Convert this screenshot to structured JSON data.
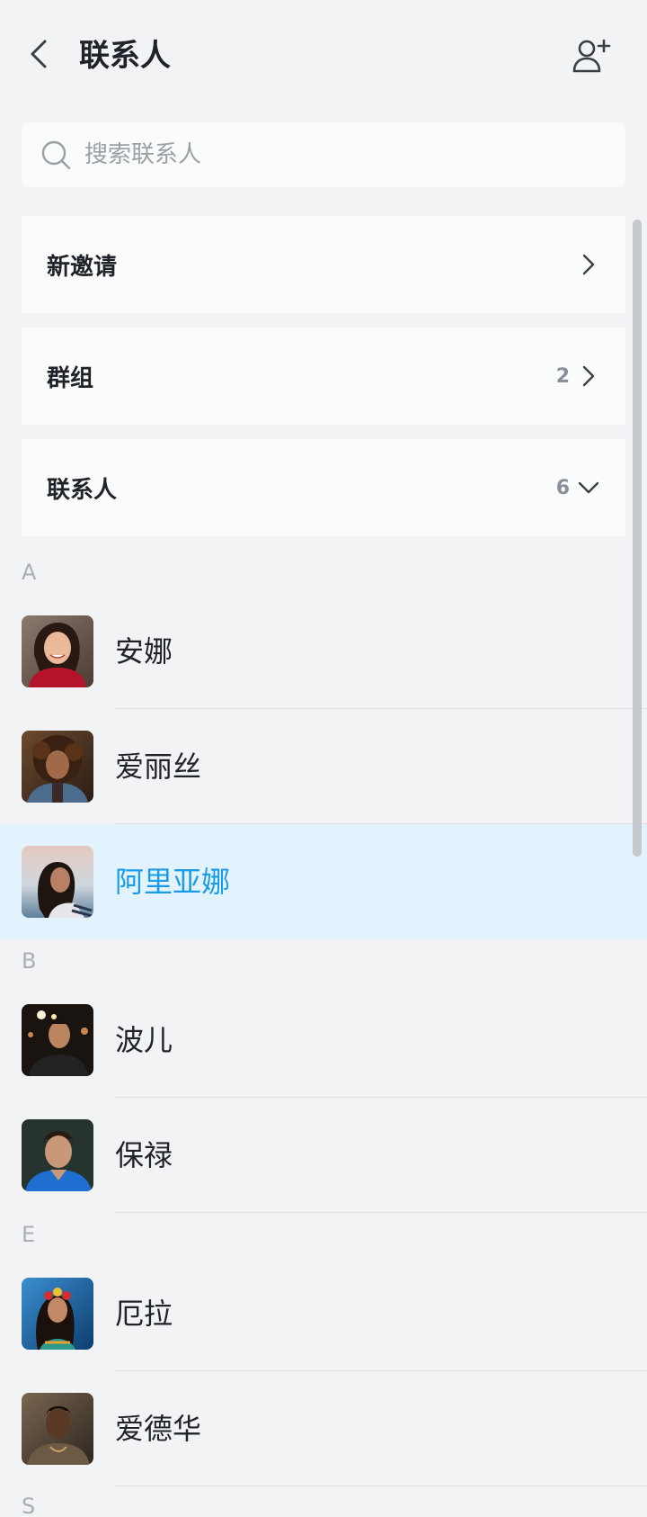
{
  "header": {
    "title": "联系人",
    "back_icon": "chevron-left-icon",
    "add_icon": "add-user-icon"
  },
  "search": {
    "placeholder": "搜索联系人",
    "value": ""
  },
  "menu": [
    {
      "label": "新邀请",
      "count": "",
      "chevron": "chevron-right-icon"
    },
    {
      "label": "群组",
      "count": "2",
      "chevron": "chevron-right-icon"
    },
    {
      "label": "联系人",
      "count": "6",
      "chevron": "chevron-down-icon"
    }
  ],
  "sections": [
    {
      "letter": "A",
      "contacts": [
        {
          "name": "安娜",
          "selected": false
        },
        {
          "name": "爱丽丝",
          "selected": false
        },
        {
          "name": "阿里亚娜",
          "selected": true
        }
      ]
    },
    {
      "letter": "B",
      "contacts": [
        {
          "name": "波儿",
          "selected": false
        },
        {
          "name": "保禄",
          "selected": false
        }
      ]
    },
    {
      "letter": "E",
      "contacts": [
        {
          "name": "厄拉",
          "selected": false
        },
        {
          "name": "爱德华",
          "selected": false
        }
      ]
    },
    {
      "letter": "S",
      "contacts": []
    }
  ],
  "colors": {
    "background": "#f2f3f5",
    "card": "#fafbfb",
    "selected_bg": "#e3f3fe",
    "selected_text": "#1a9be8",
    "section_letter": "#a9aeb6"
  }
}
